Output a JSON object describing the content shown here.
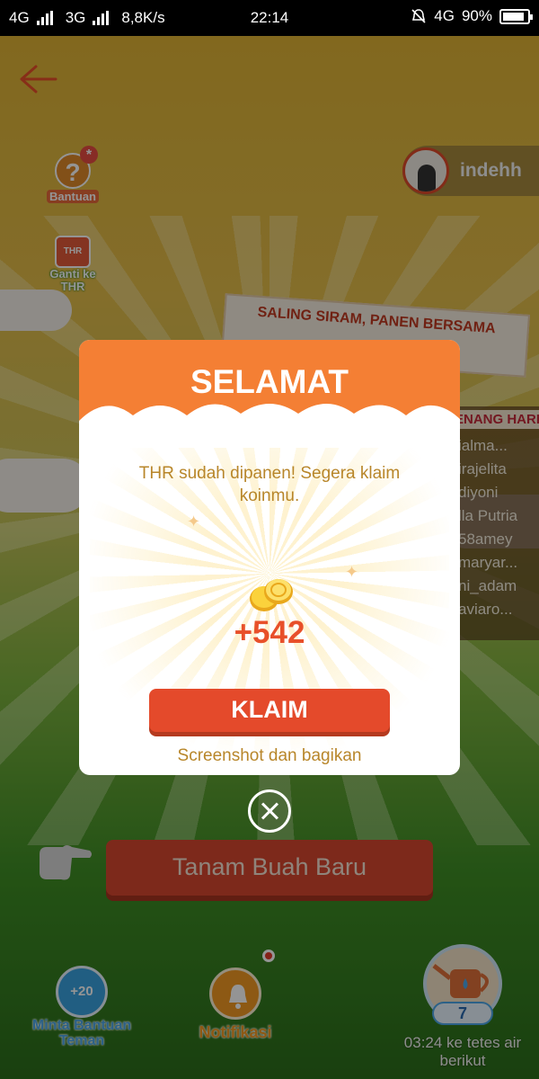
{
  "status_bar": {
    "net1": "4G",
    "net2": "3G",
    "speed": "8,8K/s",
    "time": "22:14",
    "net3": "4G",
    "battery": "90%"
  },
  "game": {
    "help_label": "Bantuan",
    "thr_badge": "THR",
    "thr_label": "Ganti ke THR",
    "username": "indehh",
    "banner_title": "SALING SIRAM, PANEN BERSAMA",
    "winners_head": "ENANG HARI INI",
    "winners": [
      "ialma...",
      "irajelita",
      "diyoni",
      "lla Putria",
      "58amey",
      "maryar...",
      "ni_adam",
      "aviaro..."
    ],
    "plant_button": "Tanam Buah Baru",
    "help_friends_badge": "+20",
    "help_friends_label": "Minta Bantuan Teman",
    "notifications_label": "Notifikasi",
    "water_count": "7",
    "water_timer": "03:24 ke tetes air berikut"
  },
  "modal": {
    "title": "SELAMAT",
    "message": "THR sudah dipanen! Segera klaim koinmu.",
    "reward": "+542",
    "claim_button": "KLAIM",
    "share_link": "Screenshot dan bagikan"
  },
  "colors": {
    "accent": "#f47f34",
    "button_red": "#e44a2b",
    "text_gold": "#b8862a"
  }
}
